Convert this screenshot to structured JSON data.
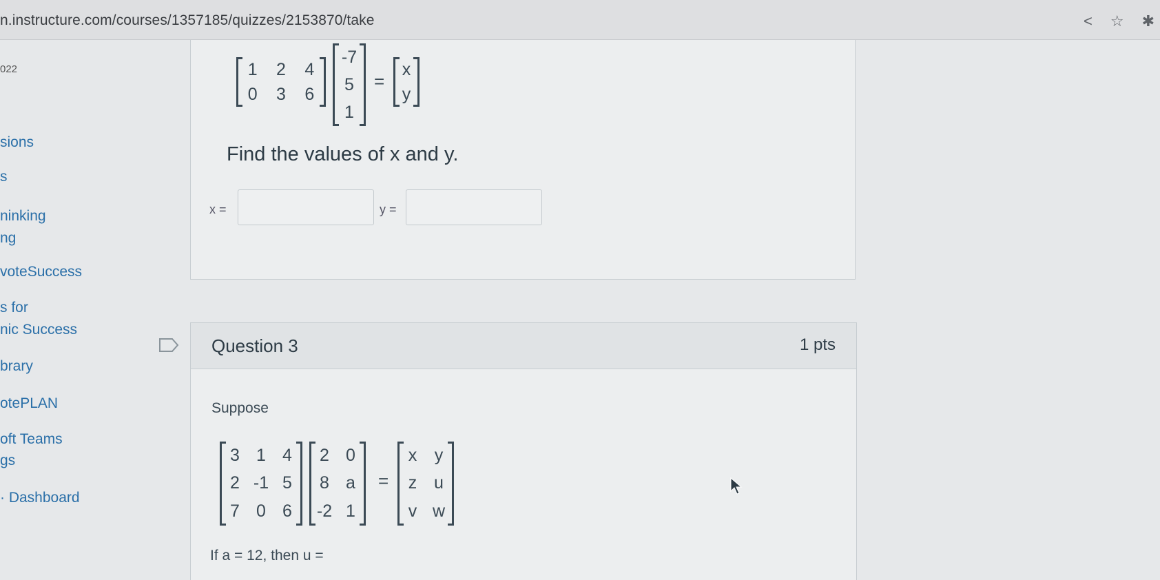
{
  "browser": {
    "url": "n.instructure.com/courses/1357185/quizzes/2153870/take",
    "icons": [
      "share-icon",
      "star-icon",
      "extension-icon"
    ]
  },
  "course_nav": {
    "year_fragment": "022",
    "items": [
      "sions",
      "s",
      "ninking",
      "ng",
      "voteSuccess",
      "s for",
      "nic Success",
      "brary",
      "otePLAN",
      "oft Teams",
      "gs",
      "· Dashboard"
    ]
  },
  "question2": {
    "matrix_a": [
      [
        "1",
        "2",
        "4"
      ],
      [
        "0",
        "3",
        "6"
      ]
    ],
    "vector_b": [
      [
        "-7"
      ],
      [
        "5"
      ],
      [
        "1"
      ]
    ],
    "result": [
      [
        "x"
      ],
      [
        "y"
      ]
    ],
    "equals": "=",
    "prompt": "Find the values of x and y.",
    "x_label": "x =",
    "y_label": "y =",
    "x_value": "",
    "y_value": ""
  },
  "question3": {
    "title": "Question 3",
    "points": "1 pts",
    "intro": "Suppose",
    "matrix_a": [
      [
        "3",
        "1",
        "4"
      ],
      [
        "2",
        "-1",
        "5"
      ],
      [
        "7",
        "0",
        "6"
      ]
    ],
    "matrix_b": [
      [
        "2",
        "0"
      ],
      [
        "8",
        "a"
      ],
      [
        "-2",
        "1"
      ]
    ],
    "result": [
      [
        "x",
        "y"
      ],
      [
        "z",
        "u"
      ],
      [
        "v",
        "w"
      ]
    ],
    "equals": "=",
    "followup": "If a = 12, then u ="
  },
  "colors": {
    "link": "#2a6fa8",
    "panel_bg": "#eceeef",
    "text": "#2d3b45"
  }
}
